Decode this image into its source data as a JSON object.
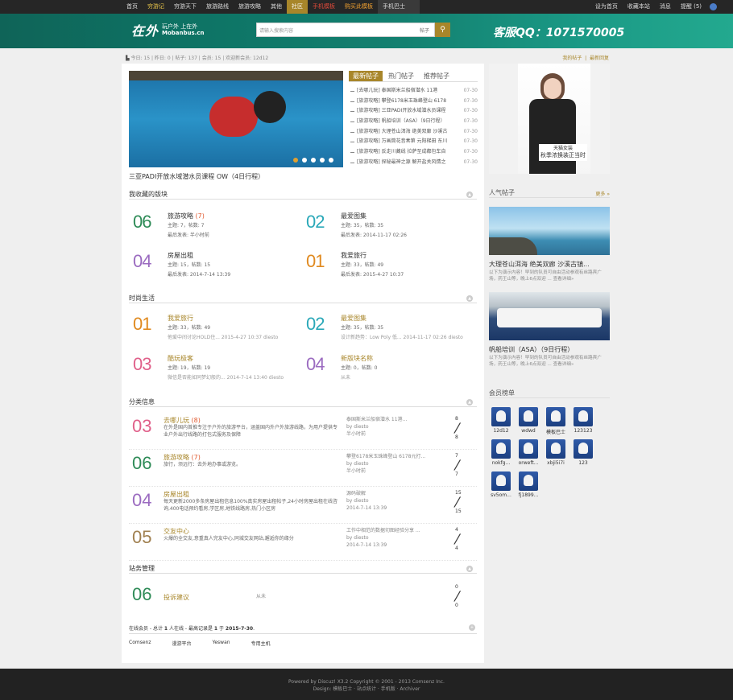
{
  "topnav": {
    "items": [
      "首页",
      "穷游记",
      "穷游天下",
      "旅游路线",
      "旅游攻略",
      "其他",
      "社区",
      "手机模板",
      "购买此模板",
      "手机巴士"
    ],
    "right": [
      "设为首页",
      "收藏本站",
      "消息",
      "提醒 (5)"
    ]
  },
  "banner": {
    "logo_big": "在外",
    "logo_small1": "玩户外 上在外",
    "logo_small2": "Mobanbus.cn",
    "search_placeholder": "请输入搜索内容",
    "search_category": "帖子",
    "qq": "客服QQ：1071570005"
  },
  "stats": {
    "text": "今日: 15  |  昨日: 0  |  帖子: 137  |  会员: 15  |  欢迎新会员: 12d12",
    "my_posts": "我的帖子",
    "latest": "最新回复"
  },
  "slide": {
    "caption": "三亚PADI开放水域潜水员课程 OW（4日行程）"
  },
  "tabs": [
    "最新帖子",
    "热门帖子",
    "推荐帖子"
  ],
  "news": [
    {
      "t": "[去哪儿玩] 泰国斯米兰船宿潜水 11港",
      "d": "07-30"
    },
    {
      "t": "[旅游攻略] 攀登6178米玉珠峰登山 6178",
      "d": "07-30"
    },
    {
      "t": "[旅游攻略] 三亚PADI开放水域潜水员课程",
      "d": "07-30"
    },
    {
      "t": "[旅游攻略] 帆船培训（ASA）（9日行程）",
      "d": "07-30"
    },
    {
      "t": "[旅游攻略] 大理苍山洱海 绝美双廊 沙溪古",
      "d": "07-30"
    },
    {
      "t": "[旅游攻略] 万画筒花音奏第 元阳梯田 东川",
      "d": "07-30"
    },
    {
      "t": "[旅游攻略] 反走川藏线 拉萨至成都包车自",
      "d": "07-30"
    },
    {
      "t": "[旅游攻略] 探秘最神之源 解开盐关风情之",
      "d": "07-30"
    }
  ],
  "sections": {
    "fav": "我收藏的版块",
    "life": "时尚生活",
    "info": "分类信息",
    "admin": "站务管理"
  },
  "fav_forums": [
    {
      "num": "06",
      "name": "旅游攻略",
      "extra": "(7)",
      "meta": "主题: 7，帖数: 7",
      "last": "最后发表: 半小时前",
      "color": "#2e8b57"
    },
    {
      "num": "02",
      "name": "最爱图集",
      "extra": "",
      "meta": "主题: 35，帖数: 35",
      "last": "最后发表: 2014-11-17 02:26",
      "color": "#2aa8b8"
    },
    {
      "num": "04",
      "name": "房屋出租",
      "extra": "",
      "meta": "主题: 15，帖数: 15",
      "last": "最后发表: 2014-7-14 13:39",
      "color": "#9b6bc0"
    },
    {
      "num": "01",
      "name": "我爱旅行",
      "extra": "",
      "meta": "主题: 33，帖数: 49",
      "last": "最后发表: 2015-4-27 10:37",
      "color": "#e08a20"
    }
  ],
  "life_forums": [
    {
      "num": "01",
      "name": "我爱旅行",
      "meta": "主题: 33，帖数: 49",
      "last": "他爱中间讨论HOLD住...  2015-4-27 10:37 diesto",
      "color": "#e08a20"
    },
    {
      "num": "02",
      "name": "最爱图集",
      "meta": "主题: 35，帖数: 35",
      "last": "设计新趋势：Low Poly 低...  2014-11-17 02:26 diesto",
      "color": "#2aa8b8"
    },
    {
      "num": "03",
      "name": "酷玩极客",
      "meta": "主题: 19，帖数: 19",
      "last": "微信是否能如同梦幻般的...  2014-7-14 13:40 diesto",
      "color": "#e0608a"
    },
    {
      "num": "04",
      "name": "新版块名称",
      "meta": "主题: 0，帖数: 0",
      "last": "从未",
      "color": "#9b6bc0"
    }
  ],
  "info_rows": [
    {
      "num": "03",
      "name": "去哪儿玩",
      "extra": "(8)",
      "desc": "在外是国内首推专注于户外的旅游平台，涵盖国内外户外旅游线路，为用户提供专业户外出行线路的打包式服务及保障",
      "l1": "泰国斯米兰船宿潜水 11港...",
      "l2": "by diesto",
      "l3": "半小时前",
      "c1": "8",
      "c2": "8",
      "color": "#e0608a"
    },
    {
      "num": "06",
      "name": "旅游攻略",
      "extra": "(7)",
      "desc": "旅行，须远行：去外地办事或游览。",
      "l1": "攀登6178米玉珠峰登山 6178元打...",
      "l2": "by diesto",
      "l3": "半小时前",
      "c1": "7",
      "c2": "7",
      "color": "#2e8b57"
    },
    {
      "num": "04",
      "name": "房屋出租",
      "extra": "",
      "desc": "每天更新2000多条房屋出租信息100%真实房屋出租帖子,24小时房屋出租在线咨询,400电话预约看房,学区房,地铁线路房,热门小区房",
      "l1": "源码破解",
      "l2": "by diesto",
      "l3": "2014-7-14 13:39",
      "c1": "15",
      "c2": "15",
      "color": "#9b6bc0"
    },
    {
      "num": "05",
      "name": "交友中心",
      "extra": "",
      "desc": "火爆的全交友,意重真人完友中心,同城交友网站,邂逅你的缘分",
      "l1": "工作中相范的数据切图经验分享 ...",
      "l2": "by diesto",
      "l3": "2014-7-14 13:39",
      "c1": "4",
      "c2": "4",
      "color": "#a08050"
    }
  ],
  "admin_row": {
    "num": "06",
    "name": "投诉建议",
    "last": "从未",
    "c1": "0",
    "c2": "0",
    "color": "#2e8b57"
  },
  "online": {
    "prefix": "在线会员 - 总计 ",
    "n": "1",
    "mid": " 人在线 - 最高记录是 ",
    "max": "1",
    "on": " 于 ",
    "date": "2015-7-30",
    "end": "."
  },
  "links": [
    "Comsenz",
    "漫游平台",
    "Yeswan",
    "专用主机"
  ],
  "side": {
    "ad_label1": "天猫女装",
    "ad_label2": "秋季浓换装正当时",
    "popular": "人气帖子",
    "more": "更多 »",
    "p1_title": "大理苍山洱海 绝美双廊 沙溪古镇...",
    "p1_text": "以下为演示内容！早到的队员可自由活动参观有丝路宾广场，药王山等，晚上6点双迎 ... 查看详细»",
    "p2_title": "帆船培训（ASA）（9日行程）",
    "p2_text": "以下为演示内容！早到的队员可自由活动参观有丝路宾广场，药王山等，晚上6点双迎 ... 查看详细»",
    "members_title": "会员榜单",
    "members": [
      "12d12",
      "wdwd",
      "模板巴士",
      "123123",
      "nokfg...",
      "orweft...",
      "xbji5i7i",
      "123",
      "sv5om...",
      "fj1899..."
    ]
  },
  "footer": {
    "line1": "Powered by Discuz! X3.2 Copyright © 2001 - 2013 Comsenz Inc.",
    "line2": "Design: 模板巴士 · 站点统计 · 手机版 · Archiver"
  }
}
